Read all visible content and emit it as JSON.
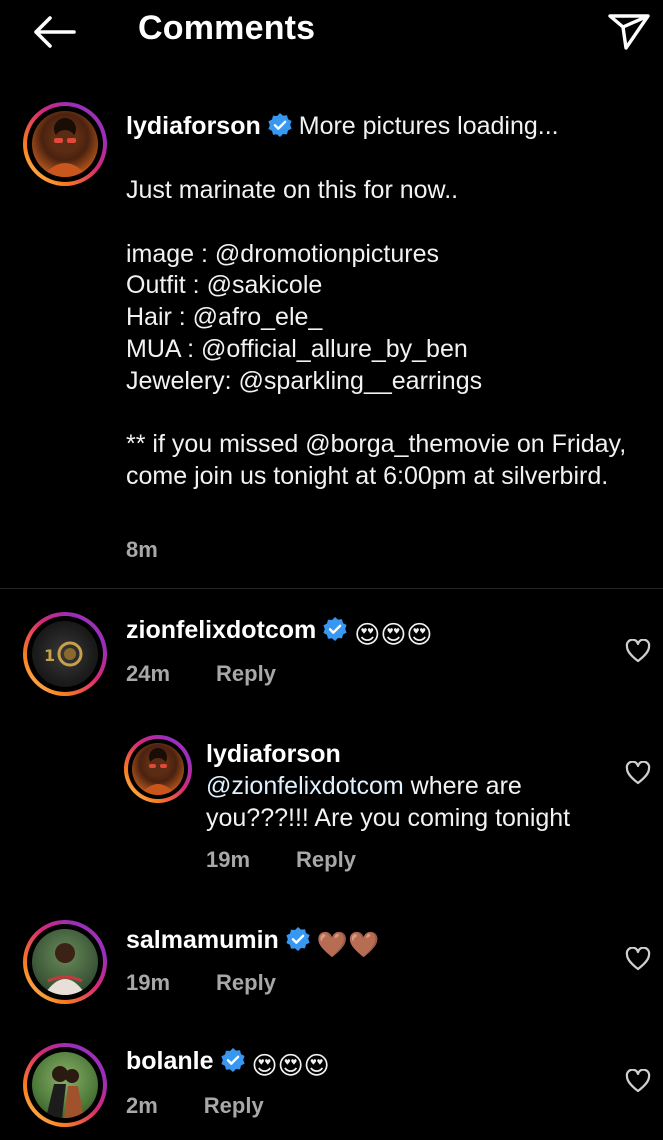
{
  "header": {
    "title": "Comments",
    "back_icon": "arrow-left-icon",
    "share_icon": "paper-plane-icon"
  },
  "caption": {
    "username": "lydiaforson",
    "verified": true,
    "first_line": "More pictures loading...",
    "body": "Just marinate on this for now..\n\nimage : @dromotionpictures\nOutfit : @sakicole\nHair : @afro_ele_\nMUA : @official_allure_by_ben\nJewelery: @sparkling__earrings\n\n** if you missed @borga_themovie on Friday, come join us tonight at 6:00pm at silverbird.",
    "time": "8m"
  },
  "comments": [
    {
      "username": "zionfelixdotcom",
      "verified": true,
      "text": "😍😍😍",
      "time": "24m",
      "reply_label": "Reply",
      "replies": [
        {
          "username": "lydiaforson",
          "mention": "@zionfelixdotcom",
          "text": " where are you???!!! Are you coming tonight",
          "time": "19m",
          "reply_label": "Reply"
        }
      ]
    },
    {
      "username": "salmamumin",
      "verified": true,
      "text": "🤎🤎",
      "time": "19m",
      "reply_label": "Reply"
    },
    {
      "username": "bolanle",
      "verified": true,
      "text": "😍😍😍",
      "time": "2m",
      "reply_label": "Reply"
    }
  ],
  "colors": {
    "background": "#000000",
    "verified_blue": "#3897f0",
    "secondary_text": "#a8a8a8",
    "mention_text": "#e0f1ff"
  }
}
